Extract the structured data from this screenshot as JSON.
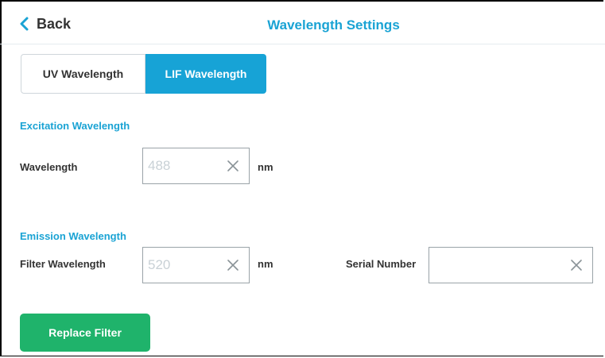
{
  "header": {
    "back_label": "Back",
    "title": "Wavelength Settings"
  },
  "tabs": [
    {
      "label": "UV Wavelength",
      "active": false
    },
    {
      "label": "LIF Wavelength",
      "active": true
    }
  ],
  "excitation": {
    "section_title": "Excitation Wavelength",
    "wavelength_label": "Wavelength",
    "wavelength_value": "488",
    "unit": "nm"
  },
  "emission": {
    "section_title": "Emission Wavelength",
    "filter_label": "Filter Wavelength",
    "filter_value": "520",
    "unit": "nm",
    "serial_label": "Serial Number",
    "serial_value": ""
  },
  "actions": {
    "replace_filter_label": "Replace Filter"
  },
  "colors": {
    "accent": "#1aa3d4",
    "active_tab": "#17a3d6",
    "primary_button": "#1fb36b"
  }
}
